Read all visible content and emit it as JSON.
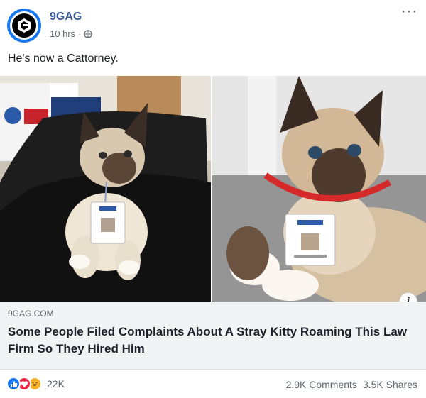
{
  "post": {
    "page_name": "9GAG",
    "time": "10 hrs",
    "separator": "·",
    "privacy_icon": "globe-icon",
    "more_icon": "ellipsis-icon",
    "caption": "He's now a Cattorney."
  },
  "link_preview": {
    "domain": "9GAG.COM",
    "title": "Some People Filed Complaints About A Stray Kitty Roaming This Law Firm So They Hired Him"
  },
  "footer": {
    "reaction_icons": [
      "like-icon",
      "love-icon",
      "haha-icon"
    ],
    "reaction_count": "22K",
    "comments": "2.9K Comments",
    "shares": "3.5K Shares"
  },
  "colors": {
    "brand_blue": "#1877f2",
    "page_name": "#385898",
    "secondary_text": "#606770",
    "link_box_bg": "#f2f3f5"
  }
}
